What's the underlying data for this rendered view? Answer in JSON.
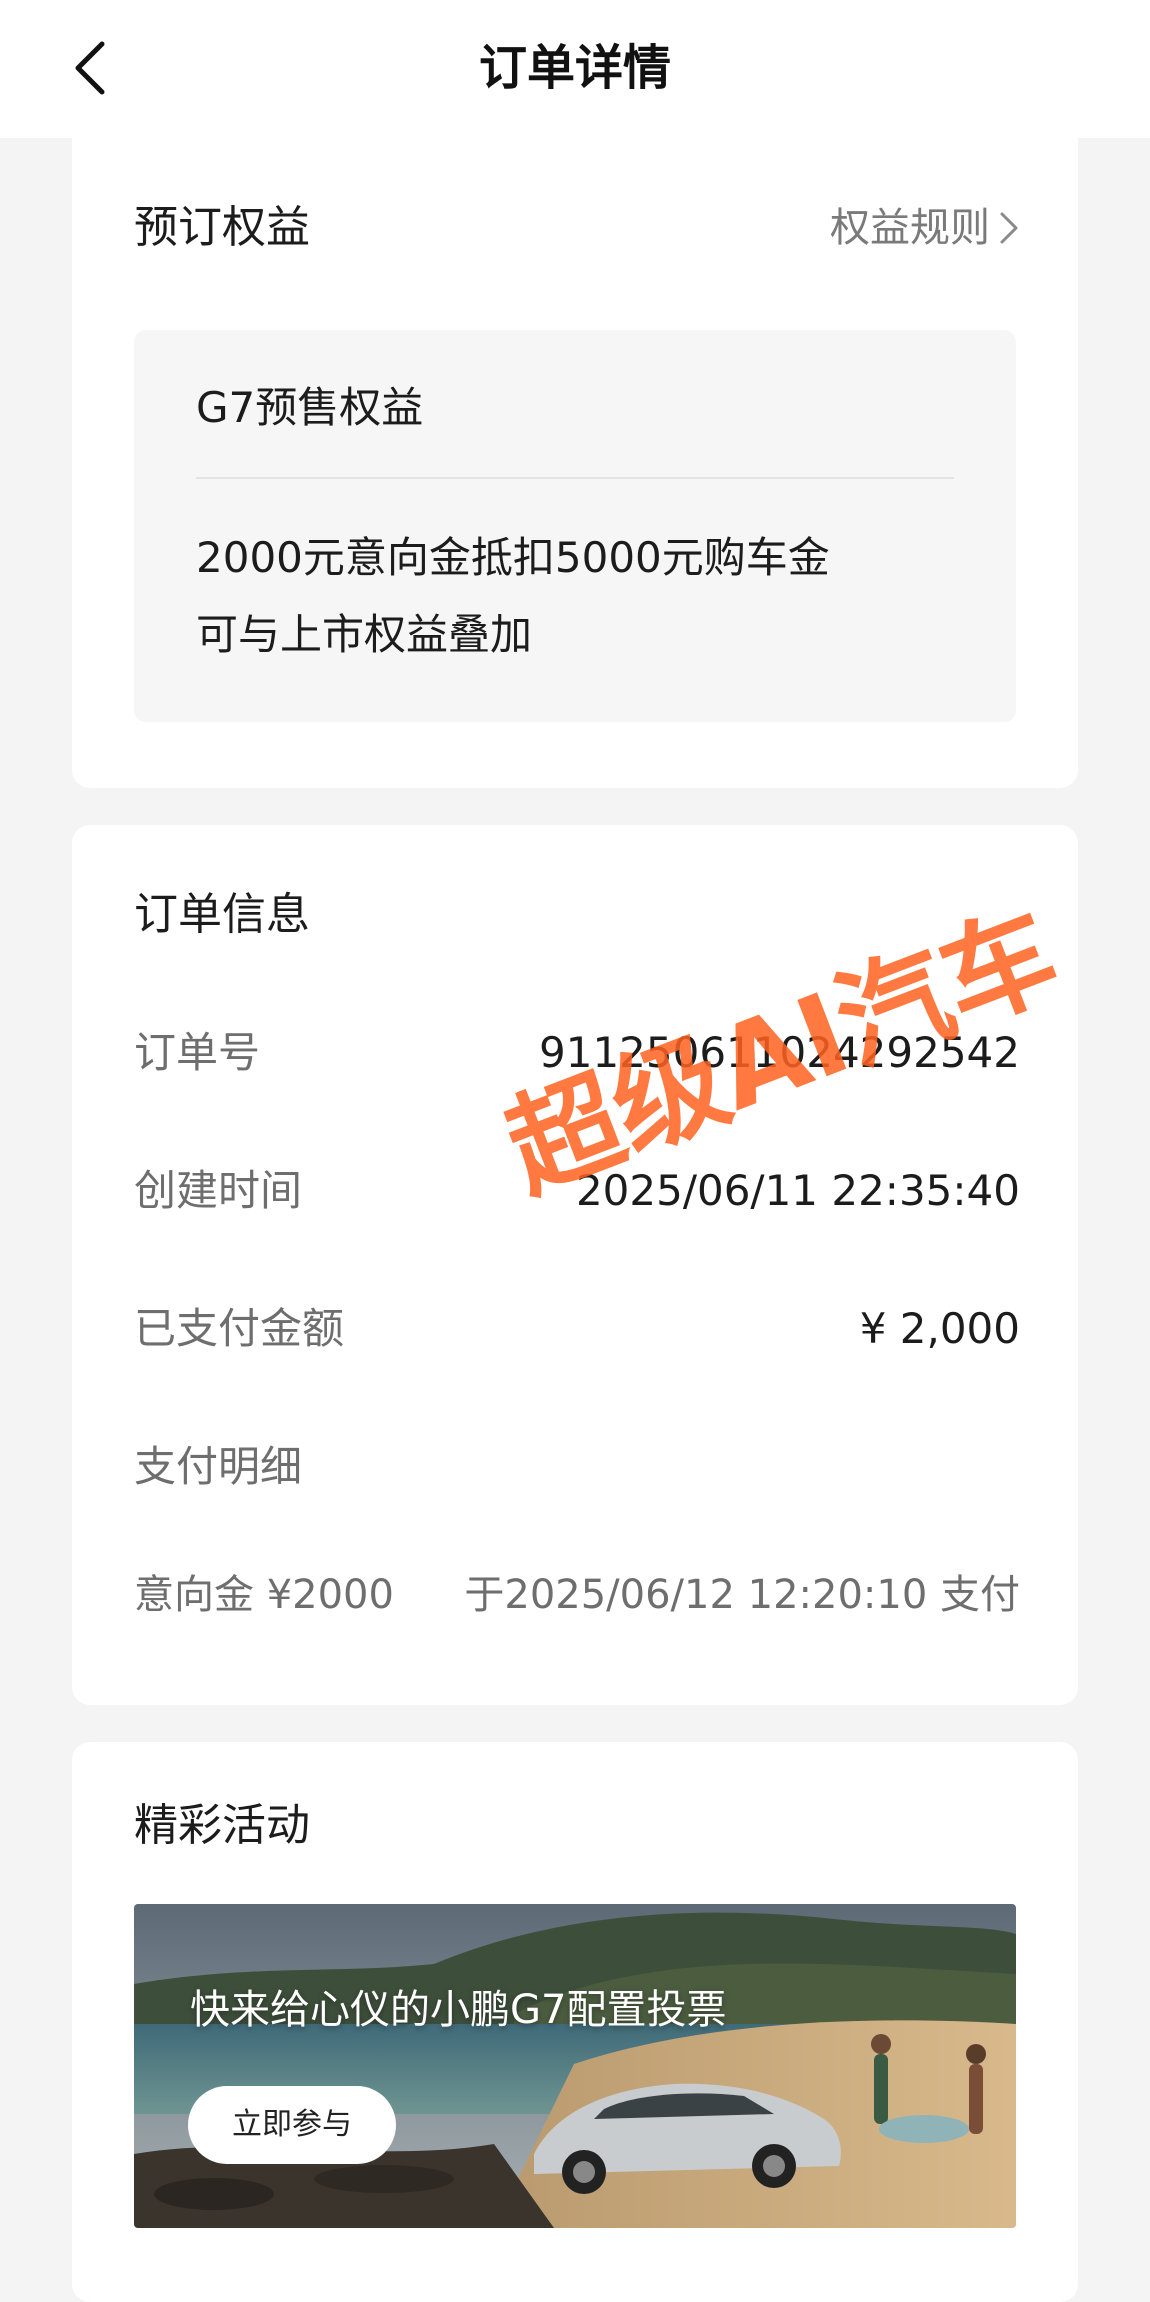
{
  "nav": {
    "title": "订单详情",
    "back_icon": "chevron-left-icon"
  },
  "benefits": {
    "title": "预订权益",
    "rules_link": "权益规则",
    "rules_icon": "chevron-right-icon",
    "box_title": "G7预售权益",
    "lines": [
      "2000元意向金抵扣5000元购车金",
      "可与上市权益叠加"
    ]
  },
  "order": {
    "title": "订单信息",
    "rows": [
      {
        "label": "订单号",
        "value": "911250611024292542"
      },
      {
        "label": "创建时间",
        "value": "2025/06/11 22:35:40"
      },
      {
        "label": "已支付金额",
        "value": "¥ 2,000"
      }
    ],
    "payment_detail_label": "支付明细",
    "payment": {
      "amount": "意向金 ¥2000",
      "time": "于2025/06/12 12:20:10 支付"
    }
  },
  "activities": {
    "title": "精彩活动",
    "banner_text": "快来给心仪的小鹏G7配置投票",
    "button": "立即参与"
  },
  "watermark": "超级AI汽车",
  "colors": {
    "watermark": "#ff621e",
    "background": "#f4f4f4",
    "card": "#ffffff"
  }
}
